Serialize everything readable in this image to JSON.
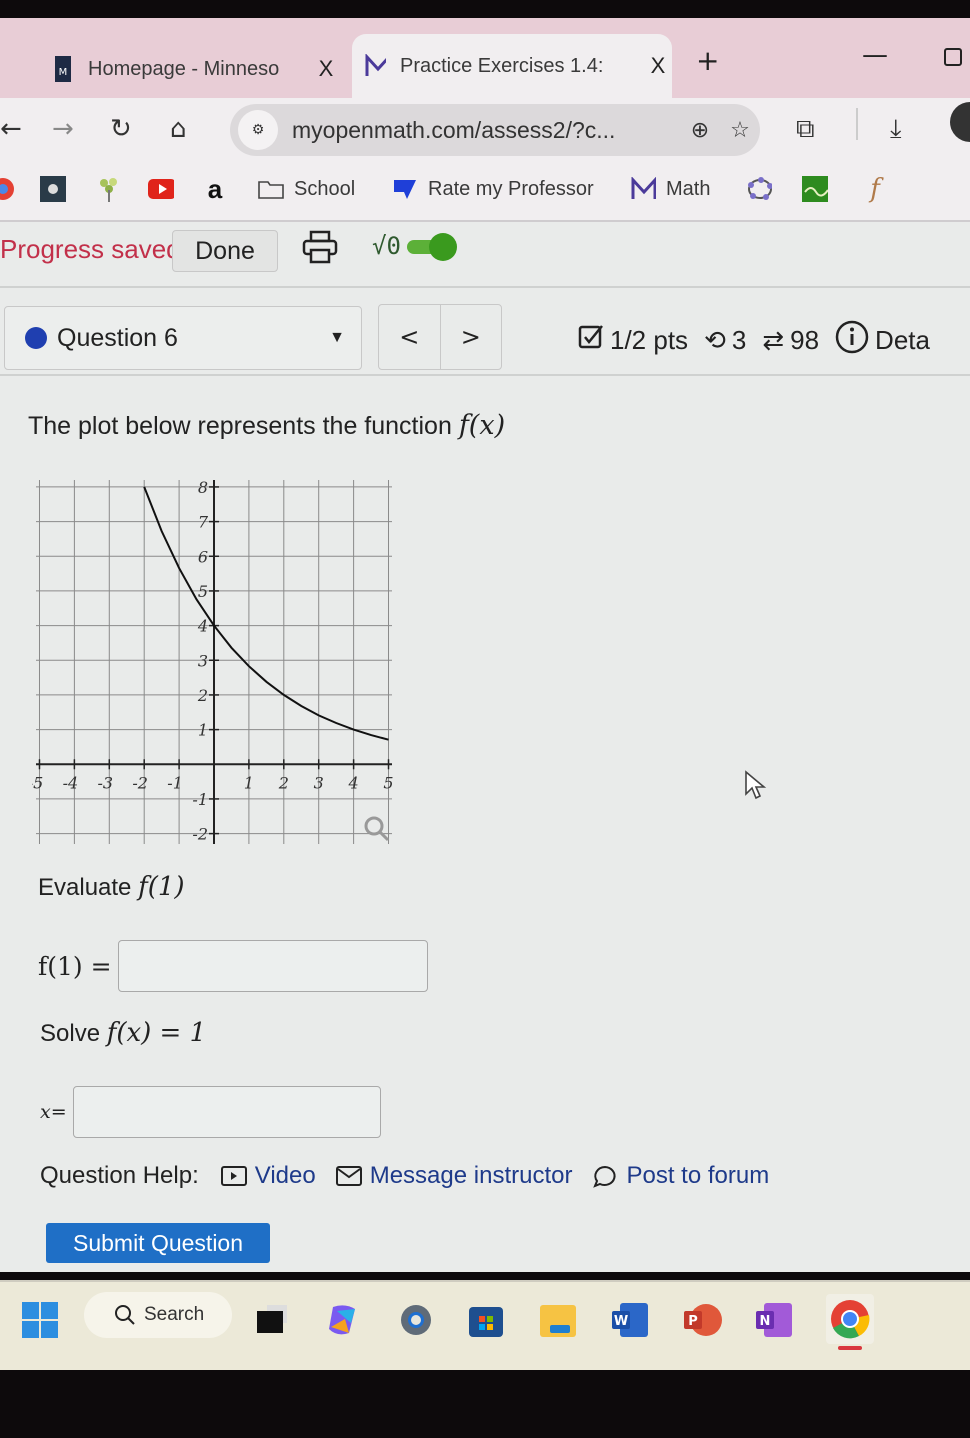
{
  "browser": {
    "tabs": [
      {
        "label": "Homepage - Minneso",
        "icon": "school-logo-icon",
        "active": false
      },
      {
        "label": "Practice Exercises 1.4:",
        "icon": "myopenmath-m-icon",
        "active": true
      }
    ],
    "new_tab_label": "+",
    "close_label": "X",
    "url": "myopenmath.com/assess2/?c...",
    "bookmarks": [
      {
        "label": "",
        "icon": "chrome-icon"
      },
      {
        "label": "",
        "icon": "app-icon"
      },
      {
        "label": "",
        "icon": "tree-icon"
      },
      {
        "label": "",
        "icon": "youtube-icon"
      },
      {
        "label": "",
        "icon": "amazon-icon"
      },
      {
        "label": "School",
        "icon": "folder-icon"
      },
      {
        "label": "Rate my Professor",
        "icon": "rmp-icon"
      },
      {
        "label": "Math",
        "icon": "myopenmath-m-icon"
      },
      {
        "label": "",
        "icon": "geogebra-icon"
      },
      {
        "label": "",
        "icon": "desmos-graph-icon"
      },
      {
        "label": "",
        "icon": "script-f-icon"
      }
    ]
  },
  "assessment": {
    "status": "Progress saved",
    "done_label": "Done",
    "math_toggle_label": "√0",
    "math_toggle_on": true,
    "question_select": "Question 6",
    "prev_label": "<",
    "next_label": ">",
    "points": "1/2 pts",
    "retries": "3",
    "attempts": "98",
    "details_label": "Deta",
    "prompt_text": "The plot below represents the function ",
    "prompt_math": "f(x)",
    "part1_text": "Evaluate ",
    "part1_math": "f(1)",
    "part1_lhs": "f(1) =",
    "part1_value": "",
    "part2_text": "Solve ",
    "part2_math": "f(x) = 1",
    "part2_lhs": "x=",
    "part2_value": "",
    "help_label": "Question Help:",
    "help_links": [
      "Video",
      "Message instructor",
      "Post to forum"
    ],
    "submit_label": "Submit Question"
  },
  "chart_data": {
    "type": "line",
    "title": "",
    "xlabel": "",
    "ylabel": "",
    "xlim": [
      -5,
      5
    ],
    "ylim": [
      -2,
      8
    ],
    "grid": true,
    "x_ticks": [
      -5,
      -4,
      -3,
      -2,
      -1,
      1,
      2,
      3,
      4,
      5
    ],
    "y_ticks": [
      -2,
      -1,
      1,
      2,
      3,
      4,
      5,
      6,
      7,
      8
    ],
    "series": [
      {
        "name": "f(x)",
        "x": [
          -2,
          -1.5,
          -1,
          -0.5,
          0,
          0.5,
          1,
          1.5,
          2,
          2.5,
          3,
          3.5,
          4,
          4.5,
          5
        ],
        "values": [
          8,
          6.73,
          5.66,
          4.76,
          4,
          3.36,
          2.83,
          2.38,
          2,
          1.68,
          1.41,
          1.19,
          1,
          0.84,
          0.71
        ]
      }
    ]
  },
  "taskbar": {
    "search_label": "Search",
    "apps": [
      "start-icon",
      "task-view-icon",
      "copilot-icon",
      "settings-icon",
      "store-icon",
      "file-explorer-icon",
      "word-icon",
      "powerpoint-icon",
      "onenote-icon",
      "chrome-icon"
    ]
  }
}
